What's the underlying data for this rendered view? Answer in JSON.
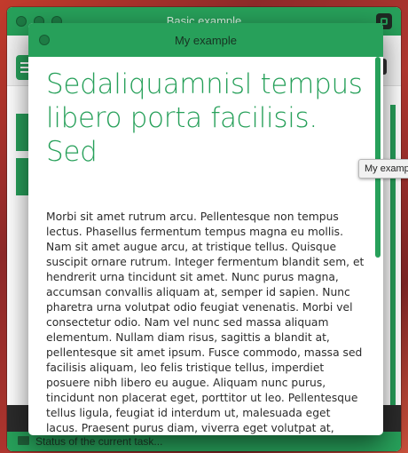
{
  "background_window": {
    "title": "Basic example",
    "status": "Status of the current task..."
  },
  "modal": {
    "title": "My example",
    "heading": "Sedaliquamnisl tempus libero porta facilisis. Sed",
    "paragraph": "Morbi sit amet rutrum arcu. Pellentesque non tempus lectus. Phasellus fermentum tempus magna eu mollis. Nam sit amet augue arcu, at tristique tellus. Quisque suscipit ornare rutrum. Integer fermentum blandit sem, et hendrerit urna tincidunt sit amet. Nunc purus magna, accumsan convallis aliquam at, semper id sapien. Nunc pharetra urna volutpat odio feugiat venenatis. Morbi vel consectetur odio. Nam vel nunc sed massa aliquam elementum. Nullam diam risus, sagittis a blandit at, pellentesque sit amet ipsum. Fusce commodo, massa sed facilisis aliquam, leo felis tristique tellus, imperdiet posuere nibh libero eu augue. Aliquam nunc purus, tincidunt non placerat eget, porttitor ut leo. Pellentesque tellus ligula, feugiat id interdum ut, malesuada eget lacus. Praesent purus diam, viverra eget volutpat at, gravida sed lacus. Mauris mi felis, varius id ornare et, placerat eu nunc. Aliquam erat"
  },
  "tooltip": {
    "text": "My examp"
  },
  "colors": {
    "accent": "#27a05a"
  }
}
